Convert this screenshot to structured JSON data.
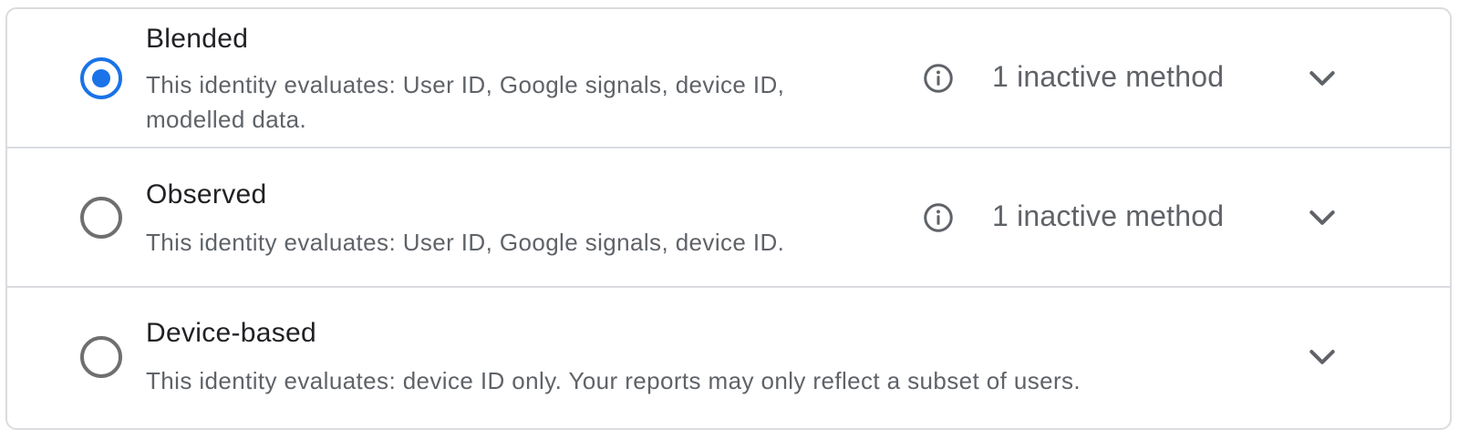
{
  "identity_options": [
    {
      "title": "Blended",
      "description": "This identity evaluates: User ID, Google signals, device ID, modelled data.",
      "selected": true,
      "inactive_methods": "1 inactive method",
      "info_icon": "info-circle-icon",
      "expand_icon": "chevron-down-icon"
    },
    {
      "title": "Observed",
      "description": "This identity evaluates: User ID, Google signals, device ID.",
      "selected": false,
      "inactive_methods": "1 inactive method",
      "info_icon": "info-circle-icon",
      "expand_icon": "chevron-down-icon"
    },
    {
      "title": "Device-based",
      "description": "This identity evaluates: device ID only. Your reports may only reflect a subset of users.",
      "selected": false,
      "expand_icon": "chevron-down-icon"
    }
  ],
  "colors": {
    "accent": "#1a73e8",
    "radio_unselected": "#6f6f6f",
    "title_text": "#202124",
    "secondary_text": "#5f6368",
    "divider": "#dadce0"
  }
}
